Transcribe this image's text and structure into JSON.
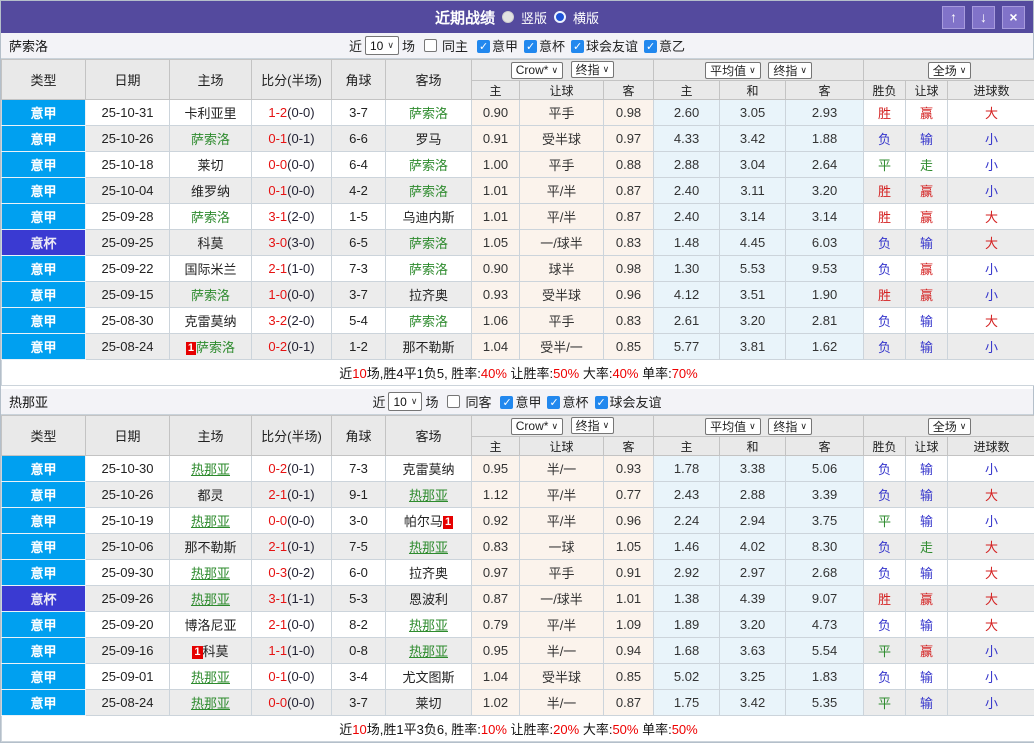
{
  "titlebar": {
    "title": "近期战绩",
    "vertical_label": "竖版",
    "horizontal_label": "横版",
    "up_icon": "↑",
    "down_icon": "↓",
    "close_icon": "×",
    "bar_color": "#544a9e",
    "button_color": "#8173c9"
  },
  "labels": {
    "near": "近",
    "matches": "场",
    "col_type": "类型",
    "col_date": "日期",
    "col_home": "主场",
    "col_score": "比分(半场)",
    "col_corner": "角球",
    "col_away": "客场",
    "col_home_s": "主",
    "col_handicap": "让球",
    "col_away_s": "客",
    "col_avg_home": "主",
    "col_avg_draw": "和",
    "col_avg_away": "客",
    "col_result": "胜负",
    "col_handicap_res": "让球",
    "col_goals": "进球数",
    "crow_select": "Crow*",
    "final_select": "终指",
    "avg_select": "平均值",
    "final_select2": "终指",
    "full_select": "全场"
  },
  "colors": {
    "league_serie_a": "#00a0f0",
    "league_cup": "#3a3ad2",
    "team_highlight": "#2e8b2e",
    "win": "#d42222",
    "lose": "#3636cc",
    "draw": "#2e8b2e",
    "score_red": "#e61212",
    "summary_red": "#ee0000",
    "handicap_col_bg": "#fbf3ec",
    "avg_col_bg": "#e9f4fa"
  },
  "sections": [
    {
      "team": "萨索洛",
      "filter": {
        "count": "10",
        "uncheck_label": "同主",
        "leagues": [
          "意甲",
          "意杯",
          "球会友谊",
          "意乙"
        ]
      },
      "rows": [
        {
          "type": "意甲",
          "cup": false,
          "date": "25-10-31",
          "home": {
            "text": "卡利亚里"
          },
          "score": "1-2",
          "half": "(0-0)",
          "corner": "3-7",
          "away": {
            "text": "萨索洛",
            "hl": true
          },
          "odds": [
            "0.90",
            "平手",
            "0.98",
            "2.60",
            "3.05",
            "2.93"
          ],
          "res": [
            [
              "胜",
              "r"
            ],
            [
              "赢",
              "r"
            ],
            [
              "大",
              "r"
            ]
          ]
        },
        {
          "type": "意甲",
          "cup": false,
          "date": "25-10-26",
          "home": {
            "text": "萨索洛",
            "hl": true
          },
          "score": "0-1",
          "half": "(0-1)",
          "corner": "6-6",
          "away": {
            "text": "罗马"
          },
          "odds": [
            "0.91",
            "受半球",
            "0.97",
            "4.33",
            "3.42",
            "1.88"
          ],
          "res": [
            [
              "负",
              "b"
            ],
            [
              "输",
              "b"
            ],
            [
              "小",
              "b"
            ]
          ]
        },
        {
          "type": "意甲",
          "cup": false,
          "date": "25-10-18",
          "home": {
            "text": "莱切"
          },
          "score": "0-0",
          "half": "(0-0)",
          "corner": "6-4",
          "away": {
            "text": "萨索洛",
            "hl": true
          },
          "odds": [
            "1.00",
            "平手",
            "0.88",
            "2.88",
            "3.04",
            "2.64"
          ],
          "res": [
            [
              "平",
              "g"
            ],
            [
              "走",
              "g"
            ],
            [
              "小",
              "b"
            ]
          ]
        },
        {
          "type": "意甲",
          "cup": false,
          "date": "25-10-04",
          "home": {
            "text": "维罗纳"
          },
          "score": "0-1",
          "half": "(0-0)",
          "corner": "4-2",
          "away": {
            "text": "萨索洛",
            "hl": true
          },
          "odds": [
            "1.01",
            "平/半",
            "0.87",
            "2.40",
            "3.11",
            "3.20"
          ],
          "res": [
            [
              "胜",
              "r"
            ],
            [
              "赢",
              "r"
            ],
            [
              "小",
              "b"
            ]
          ]
        },
        {
          "type": "意甲",
          "cup": false,
          "date": "25-09-28",
          "home": {
            "text": "萨索洛",
            "hl": true
          },
          "score": "3-1",
          "half": "(2-0)",
          "corner": "1-5",
          "away": {
            "text": "乌迪内斯"
          },
          "odds": [
            "1.01",
            "平/半",
            "0.87",
            "2.40",
            "3.14",
            "3.14"
          ],
          "res": [
            [
              "胜",
              "r"
            ],
            [
              "赢",
              "r"
            ],
            [
              "大",
              "r"
            ]
          ]
        },
        {
          "type": "意杯",
          "cup": true,
          "date": "25-09-25",
          "home": {
            "text": "科莫"
          },
          "score": "3-0",
          "half": "(3-0)",
          "corner": "6-5",
          "away": {
            "text": "萨索洛",
            "hl": true
          },
          "odds": [
            "1.05",
            "一/球半",
            "0.83",
            "1.48",
            "4.45",
            "6.03"
          ],
          "res": [
            [
              "负",
              "b"
            ],
            [
              "输",
              "b"
            ],
            [
              "大",
              "r"
            ]
          ]
        },
        {
          "type": "意甲",
          "cup": false,
          "date": "25-09-22",
          "home": {
            "text": "国际米兰"
          },
          "score": "2-1",
          "half": "(1-0)",
          "corner": "7-3",
          "away": {
            "text": "萨索洛",
            "hl": true
          },
          "odds": [
            "0.90",
            "球半",
            "0.98",
            "1.30",
            "5.53",
            "9.53"
          ],
          "res": [
            [
              "负",
              "b"
            ],
            [
              "赢",
              "r"
            ],
            [
              "小",
              "b"
            ]
          ]
        },
        {
          "type": "意甲",
          "cup": false,
          "date": "25-09-15",
          "home": {
            "text": "萨索洛",
            "hl": true
          },
          "score": "1-0",
          "half": "(0-0)",
          "corner": "3-7",
          "away": {
            "text": "拉齐奥"
          },
          "odds": [
            "0.93",
            "受半球",
            "0.96",
            "4.12",
            "3.51",
            "1.90"
          ],
          "res": [
            [
              "胜",
              "r"
            ],
            [
              "赢",
              "r"
            ],
            [
              "小",
              "b"
            ]
          ]
        },
        {
          "type": "意甲",
          "cup": false,
          "date": "25-08-30",
          "home": {
            "text": "克雷莫纳"
          },
          "score": "3-2",
          "half": "(2-0)",
          "corner": "5-4",
          "away": {
            "text": "萨索洛",
            "hl": true
          },
          "odds": [
            "1.06",
            "平手",
            "0.83",
            "2.61",
            "3.20",
            "2.81"
          ],
          "res": [
            [
              "负",
              "b"
            ],
            [
              "输",
              "b"
            ],
            [
              "大",
              "r"
            ]
          ]
        },
        {
          "type": "意甲",
          "cup": false,
          "date": "25-08-24",
          "home": {
            "text": "萨索洛",
            "hl": true,
            "badge": "1",
            "badge_pos": "before"
          },
          "score": "0-2",
          "half": "(0-1)",
          "corner": "1-2",
          "away": {
            "text": "那不勒斯"
          },
          "odds": [
            "1.04",
            "受半/一",
            "0.85",
            "5.77",
            "3.81",
            "1.62"
          ],
          "res": [
            [
              "负",
              "b"
            ],
            [
              "输",
              "b"
            ],
            [
              "小",
              "b"
            ]
          ]
        }
      ],
      "summary": [
        [
          "近",
          0
        ],
        [
          "10",
          1
        ],
        [
          "场,胜4平1负5, 胜率:",
          0
        ],
        [
          "40%",
          1
        ],
        [
          " 让胜率:",
          0
        ],
        [
          "50%",
          1
        ],
        [
          " 大率:",
          0
        ],
        [
          "40%",
          1
        ],
        [
          " 单率:",
          0
        ],
        [
          "70%",
          1
        ]
      ]
    },
    {
      "team": "热那亚",
      "filter": {
        "count": "10",
        "uncheck_label": "同客",
        "leagues": [
          "意甲",
          "意杯",
          "球会友谊"
        ]
      },
      "rows": [
        {
          "type": "意甲",
          "cup": false,
          "date": "25-10-30",
          "home": {
            "text": "热那亚",
            "hl": true,
            "u": true
          },
          "score": "0-2",
          "half": "(0-1)",
          "corner": "7-3",
          "away": {
            "text": "克雷莫纳"
          },
          "odds": [
            "0.95",
            "半/一",
            "0.93",
            "1.78",
            "3.38",
            "5.06"
          ],
          "res": [
            [
              "负",
              "b"
            ],
            [
              "输",
              "b"
            ],
            [
              "小",
              "b"
            ]
          ]
        },
        {
          "type": "意甲",
          "cup": false,
          "date": "25-10-26",
          "home": {
            "text": "都灵"
          },
          "score": "2-1",
          "half": "(0-1)",
          "corner": "9-1",
          "away": {
            "text": "热那亚",
            "hl": true,
            "u": true
          },
          "odds": [
            "1.12",
            "平/半",
            "0.77",
            "2.43",
            "2.88",
            "3.39"
          ],
          "res": [
            [
              "负",
              "b"
            ],
            [
              "输",
              "b"
            ],
            [
              "大",
              "r"
            ]
          ]
        },
        {
          "type": "意甲",
          "cup": false,
          "date": "25-10-19",
          "home": {
            "text": "热那亚",
            "hl": true,
            "u": true
          },
          "score": "0-0",
          "half": "(0-0)",
          "corner": "3-0",
          "away": {
            "text": "帕尔马",
            "badge": "1",
            "badge_pos": "after"
          },
          "odds": [
            "0.92",
            "平/半",
            "0.96",
            "2.24",
            "2.94",
            "3.75"
          ],
          "res": [
            [
              "平",
              "g"
            ],
            [
              "输",
              "b"
            ],
            [
              "小",
              "b"
            ]
          ]
        },
        {
          "type": "意甲",
          "cup": false,
          "date": "25-10-06",
          "home": {
            "text": "那不勒斯"
          },
          "score": "2-1",
          "half": "(0-1)",
          "corner": "7-5",
          "away": {
            "text": "热那亚",
            "hl": true,
            "u": true
          },
          "odds": [
            "0.83",
            "一球",
            "1.05",
            "1.46",
            "4.02",
            "8.30"
          ],
          "res": [
            [
              "负",
              "b"
            ],
            [
              "走",
              "g"
            ],
            [
              "大",
              "r"
            ]
          ]
        },
        {
          "type": "意甲",
          "cup": false,
          "date": "25-09-30",
          "home": {
            "text": "热那亚",
            "hl": true,
            "u": true
          },
          "score": "0-3",
          "half": "(0-2)",
          "corner": "6-0",
          "away": {
            "text": "拉齐奥"
          },
          "odds": [
            "0.97",
            "平手",
            "0.91",
            "2.92",
            "2.97",
            "2.68"
          ],
          "res": [
            [
              "负",
              "b"
            ],
            [
              "输",
              "b"
            ],
            [
              "大",
              "r"
            ]
          ]
        },
        {
          "type": "意杯",
          "cup": true,
          "date": "25-09-26",
          "home": {
            "text": "热那亚",
            "hl": true,
            "u": true
          },
          "score": "3-1",
          "half": "(1-1)",
          "corner": "5-3",
          "away": {
            "text": "恩波利"
          },
          "odds": [
            "0.87",
            "一/球半",
            "1.01",
            "1.38",
            "4.39",
            "9.07"
          ],
          "res": [
            [
              "胜",
              "r"
            ],
            [
              "赢",
              "r"
            ],
            [
              "大",
              "r"
            ]
          ]
        },
        {
          "type": "意甲",
          "cup": false,
          "date": "25-09-20",
          "home": {
            "text": "博洛尼亚"
          },
          "score": "2-1",
          "half": "(0-0)",
          "corner": "8-2",
          "away": {
            "text": "热那亚",
            "hl": true,
            "u": true
          },
          "odds": [
            "0.79",
            "平/半",
            "1.09",
            "1.89",
            "3.20",
            "4.73"
          ],
          "res": [
            [
              "负",
              "b"
            ],
            [
              "输",
              "b"
            ],
            [
              "大",
              "r"
            ]
          ]
        },
        {
          "type": "意甲",
          "cup": false,
          "date": "25-09-16",
          "home": {
            "text": "科莫",
            "badge": "1",
            "badge_pos": "before"
          },
          "score": "1-1",
          "half": "(1-0)",
          "corner": "0-8",
          "away": {
            "text": "热那亚",
            "hl": true,
            "u": true
          },
          "odds": [
            "0.95",
            "半/一",
            "0.94",
            "1.68",
            "3.63",
            "5.54"
          ],
          "res": [
            [
              "平",
              "g"
            ],
            [
              "赢",
              "r"
            ],
            [
              "小",
              "b"
            ]
          ]
        },
        {
          "type": "意甲",
          "cup": false,
          "date": "25-09-01",
          "home": {
            "text": "热那亚",
            "hl": true,
            "u": true
          },
          "score": "0-1",
          "half": "(0-0)",
          "corner": "3-4",
          "away": {
            "text": "尤文图斯"
          },
          "odds": [
            "1.04",
            "受半球",
            "0.85",
            "5.02",
            "3.25",
            "1.83"
          ],
          "res": [
            [
              "负",
              "b"
            ],
            [
              "输",
              "b"
            ],
            [
              "小",
              "b"
            ]
          ]
        },
        {
          "type": "意甲",
          "cup": false,
          "date": "25-08-24",
          "home": {
            "text": "热那亚",
            "hl": true,
            "u": true
          },
          "score": "0-0",
          "half": "(0-0)",
          "corner": "3-7",
          "away": {
            "text": "莱切"
          },
          "odds": [
            "1.02",
            "半/一",
            "0.87",
            "1.75",
            "3.42",
            "5.35"
          ],
          "res": [
            [
              "平",
              "g"
            ],
            [
              "输",
              "b"
            ],
            [
              "小",
              "b"
            ]
          ]
        }
      ],
      "summary": [
        [
          "近",
          0
        ],
        [
          "10",
          1
        ],
        [
          "场,胜1平3负6, 胜率:",
          0
        ],
        [
          "10%",
          1
        ],
        [
          " 让胜率:",
          0
        ],
        [
          "20%",
          1
        ],
        [
          " 大率:",
          0
        ],
        [
          "50%",
          1
        ],
        [
          " 单率:",
          0
        ],
        [
          "50%",
          1
        ]
      ]
    }
  ]
}
